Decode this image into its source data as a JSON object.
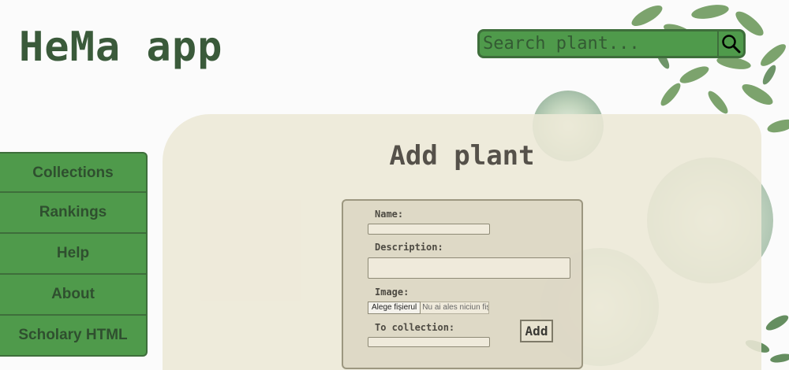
{
  "app": {
    "title": "HeMa app"
  },
  "search": {
    "placeholder": "Search plant..."
  },
  "sidebar": {
    "items": [
      {
        "label": "Collections"
      },
      {
        "label": "Rankings"
      },
      {
        "label": "Help"
      },
      {
        "label": "About"
      },
      {
        "label": "Scholary HTML"
      }
    ]
  },
  "form": {
    "title": "Add plant",
    "name_label": "Name:",
    "description_label": "Description:",
    "image_label": "Image:",
    "file_button": "Alege fișierul",
    "file_status": "Nu ai ales niciun fișier",
    "collection_label": "To collection:",
    "submit_label": "Add"
  },
  "icons": {
    "search": "magnifier-icon"
  },
  "colors": {
    "accent_green": "#4f9a4b",
    "dark_green": "#3a5a3a",
    "panel_beige": "#ece8d6"
  }
}
